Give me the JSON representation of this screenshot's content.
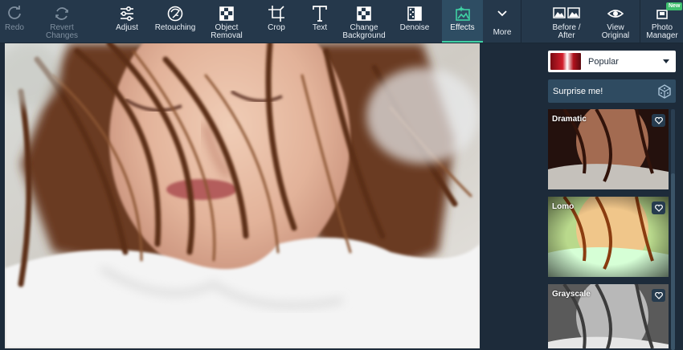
{
  "toolbar": {
    "items": [
      {
        "label_1": "Redo",
        "label_2": "",
        "icon": "redo-icon",
        "state": "disabled"
      },
      {
        "label_1": "Revert",
        "label_2": "Changes",
        "icon": "revert-icon",
        "state": "disabled"
      },
      {
        "label_1": "Adjust",
        "label_2": "",
        "icon": "sliders-icon",
        "state": "normal"
      },
      {
        "label_1": "Retouching",
        "label_2": "",
        "icon": "face-icon",
        "state": "normal"
      },
      {
        "label_1": "Object",
        "label_2": "Removal",
        "icon": "object-removal-icon",
        "state": "normal"
      },
      {
        "label_1": "Crop",
        "label_2": "",
        "icon": "crop-icon",
        "state": "normal"
      },
      {
        "label_1": "Text",
        "label_2": "",
        "icon": "text-icon",
        "state": "normal"
      },
      {
        "label_1": "Change",
        "label_2": "Background",
        "icon": "change-background-icon",
        "state": "normal"
      },
      {
        "label_1": "Denoise",
        "label_2": "",
        "icon": "denoise-icon",
        "state": "normal"
      },
      {
        "label_1": "Effects",
        "label_2": "",
        "icon": "effects-icon",
        "state": "active"
      },
      {
        "label_1": "More",
        "label_2": "",
        "icon": "chevron-down-icon",
        "state": "normal"
      },
      {
        "label_1": "Before /",
        "label_2": "After",
        "icon": "before-after-icon",
        "state": "normal"
      },
      {
        "label_1": "View",
        "label_2": "Original",
        "icon": "eye-icon",
        "state": "normal"
      },
      {
        "label_1": "Photo",
        "label_2": "Manager",
        "icon": "photo-manager-icon",
        "state": "normal",
        "badge": "New"
      }
    ]
  },
  "panel": {
    "category": "Popular",
    "surprise_label": "Surprise me!",
    "effects": [
      {
        "name": "Dramatic"
      },
      {
        "name": "Lomo"
      },
      {
        "name": "Grayscale"
      }
    ]
  },
  "colors": {
    "toolbar_bg": "#25384b",
    "app_bg": "#1d2b3a",
    "accent": "#3fd1a4",
    "badge": "#3fbf6f"
  }
}
